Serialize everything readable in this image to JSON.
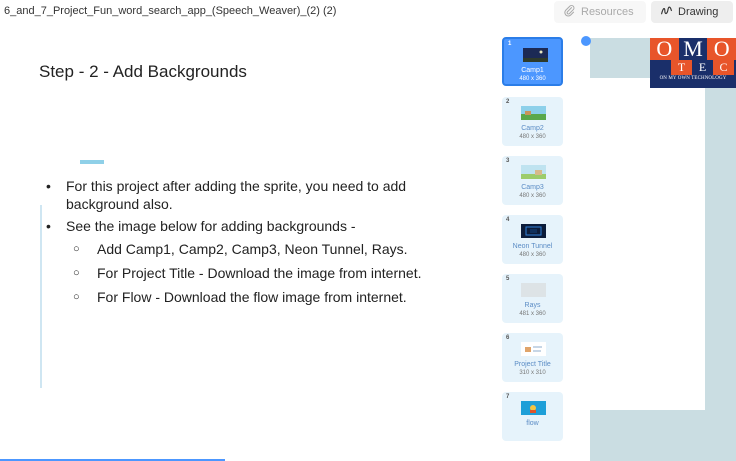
{
  "topbar": {
    "filename": "6_and_7_Project_Fun_word_search_app_(Speech_Weaver)_(2) (2)",
    "resources_label": "Resources",
    "drawing_label": "Drawing"
  },
  "slide": {
    "title": "Step - 2 - Add Backgrounds",
    "bullets": [
      "For this project after adding the sprite, you need to add background also.",
      "See the image below for adding backgrounds -"
    ],
    "sub_bullets": [
      "Add Camp1, Camp2, Camp3, Neon Tunnel, Rays.",
      "For Project Title - Download the image from internet.",
      "For Flow - Download the flow image from internet."
    ]
  },
  "backdrops": [
    {
      "num": "1",
      "name": "Camp1",
      "size": "480 x 360",
      "selected": true
    },
    {
      "num": "2",
      "name": "Camp2",
      "size": "480 x 360",
      "selected": false
    },
    {
      "num": "3",
      "name": "Camp3",
      "size": "480 x 360",
      "selected": false
    },
    {
      "num": "4",
      "name": "Neon Tunnel",
      "size": "480 x 360",
      "selected": false
    },
    {
      "num": "5",
      "name": "Rays",
      "size": "481 x 360",
      "selected": false
    },
    {
      "num": "6",
      "name": "Project Title",
      "size": "310 x 310",
      "selected": false
    },
    {
      "num": "7",
      "name": "flow",
      "size": "",
      "selected": false
    }
  ],
  "logo": {
    "row1": [
      "O",
      "M",
      "O"
    ],
    "row2": [
      "T",
      "E",
      "C"
    ],
    "tagline": "ON MY OWN TECHNOLOGY"
  },
  "colors": {
    "accent": "#4c97ff",
    "logo_orange": "#e8552a",
    "logo_navy": "#1a2f6a",
    "right_bg": "#cadde2"
  },
  "icons": {
    "resources": "paperclip-icon",
    "drawing": "scribble-icon"
  }
}
